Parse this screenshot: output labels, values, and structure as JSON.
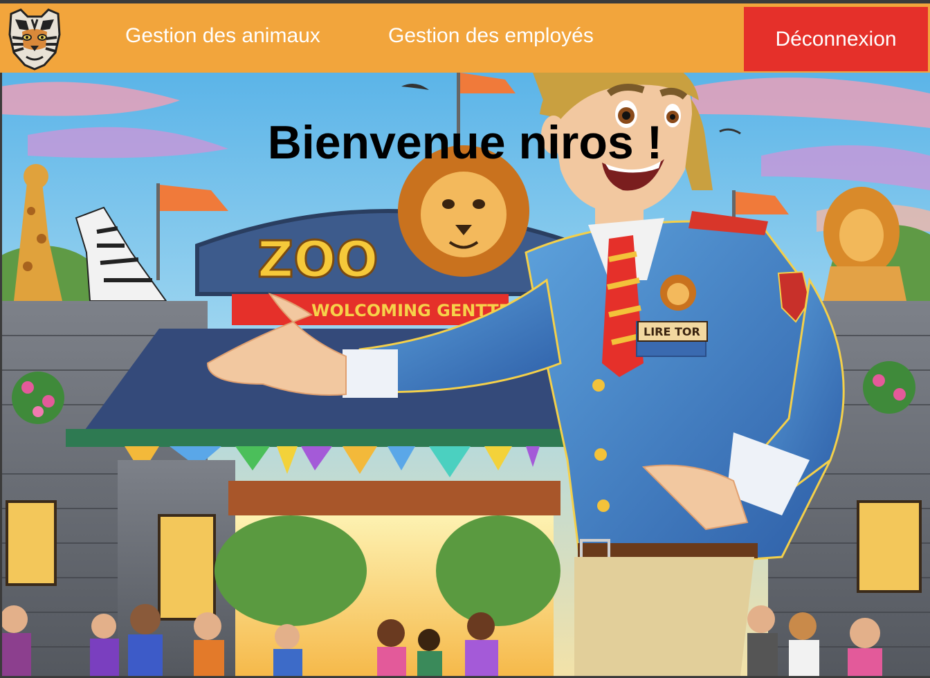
{
  "navbar": {
    "logo_icon": "tiger-head-icon",
    "links": [
      {
        "label": "Gestion des animaux"
      },
      {
        "label": "Gestion des employés"
      }
    ],
    "logout_label": "Déconnexion",
    "colors": {
      "bar": "#f2a53c",
      "logout": "#e5302a",
      "text": "#ffffff"
    }
  },
  "hero": {
    "welcome": "Bienvenue niros !",
    "background_image": "cartoon zoo entrance with smiling zookeeper in blue uniform, lion emblem, giraffe, zebra and visitors",
    "sign": {
      "title": "ZOO",
      "banner": "WOLCOMING GENTTES"
    },
    "badge": "LIRE TOR"
  }
}
